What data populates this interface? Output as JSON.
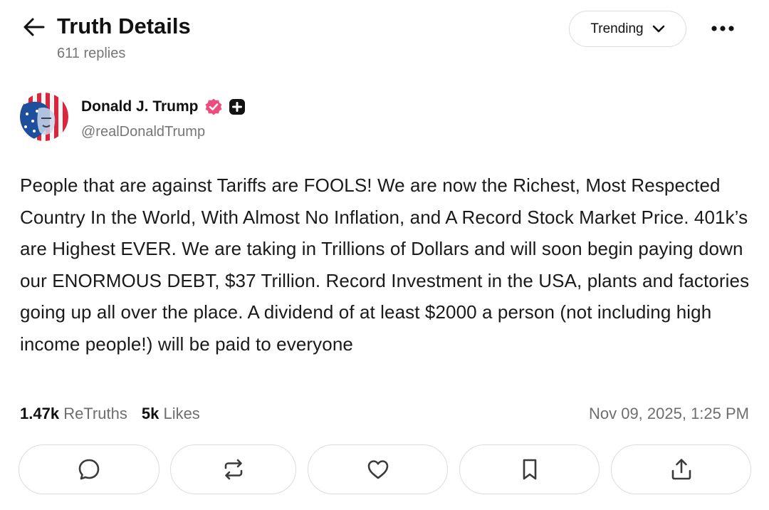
{
  "header": {
    "title": "Truth Details",
    "reply_count": "611 replies",
    "sort_label": "Trending"
  },
  "post": {
    "author": {
      "name": "Donald J. Trump",
      "handle": "@realDonaldTrump",
      "verified": true
    },
    "body": "People that are against Tariffs are FOOLS! We are now the Richest, Most Respected Country In the World, With Almost No Inflation, and A Record Stock Market Price. 401k’s are Highest EVER. We are taking in Trillions of Dollars and will soon begin paying down our ENORMOUS DEBT, $37 Trillion. Record Investment in the USA, plants and factories going up all over the place. A dividend of at least $2000 a person (not including high income people!) will be paid to everyone",
    "stats": {
      "retruths_count": "1.47k",
      "retruths_label": "ReTruths",
      "likes_count": "5k",
      "likes_label": "Likes"
    },
    "timestamp": "Nov 09, 2025, 1:25 PM"
  },
  "actions": [
    {
      "name": "reply-button",
      "icon": "comment-icon"
    },
    {
      "name": "retruth-button",
      "icon": "repost-icon"
    },
    {
      "name": "like-button",
      "icon": "heart-icon"
    },
    {
      "name": "bookmark-button",
      "icon": "bookmark-icon"
    },
    {
      "name": "share-button",
      "icon": "share-icon"
    }
  ],
  "colors": {
    "verified_badge": "#ee4c7c",
    "muted_text": "#767676",
    "border": "#dcdcdc"
  }
}
